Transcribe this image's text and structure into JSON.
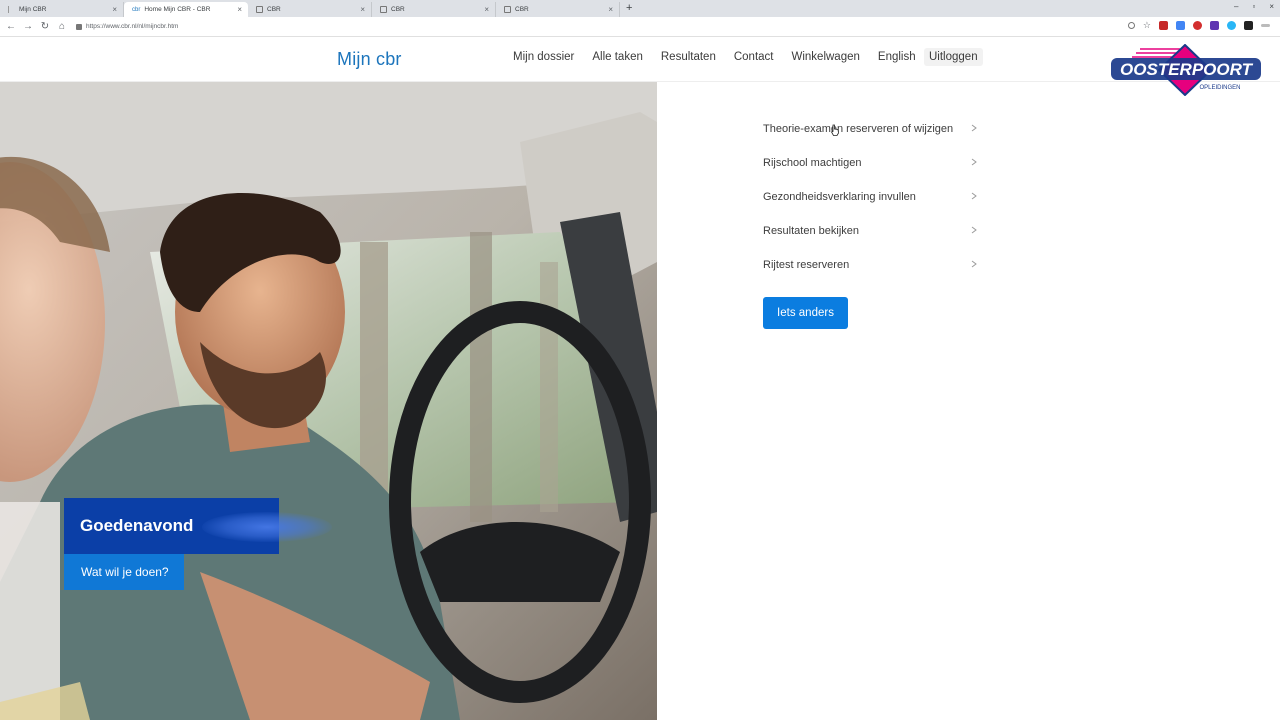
{
  "browser": {
    "tabs": [
      {
        "label": "Mijn CBR",
        "active": false
      },
      {
        "label": "Home Mijn CBR - CBR",
        "active": true
      },
      {
        "label": "CBR",
        "active": false
      },
      {
        "label": "CBR",
        "active": false
      },
      {
        "label": "CBR",
        "active": false
      }
    ],
    "url": "https://www.cbr.nl/nl/mijncbr.htm"
  },
  "header": {
    "brand": "Mijn cbr",
    "nav": [
      {
        "label": "Mijn dossier"
      },
      {
        "label": "Alle taken"
      },
      {
        "label": "Resultaten"
      },
      {
        "label": "Contact"
      },
      {
        "label": "Winkelwagen"
      },
      {
        "label": "English"
      }
    ],
    "logout": "Uitloggen"
  },
  "logo": {
    "name": "OOSTERPOORT",
    "sub": "OPLEIDINGEN",
    "colors": {
      "blue": "#1a3a8a",
      "pink": "#e6007e"
    }
  },
  "hero": {
    "greeting": "Goedenavond",
    "prompt": "Wat wil je doen?"
  },
  "tasks": [
    {
      "label": "Theorie-examen reserveren of wijzigen"
    },
    {
      "label": "Rijschool machtigen"
    },
    {
      "label": "Gezondheidsverklaring invullen"
    },
    {
      "label": "Resultaten bekijken"
    },
    {
      "label": "Rijtest reserveren"
    }
  ],
  "cta": "Iets anders",
  "colors": {
    "brand_blue": "#1c75bc",
    "button_blue": "#0b7de0",
    "greet_navy": "#0b3fa7"
  }
}
